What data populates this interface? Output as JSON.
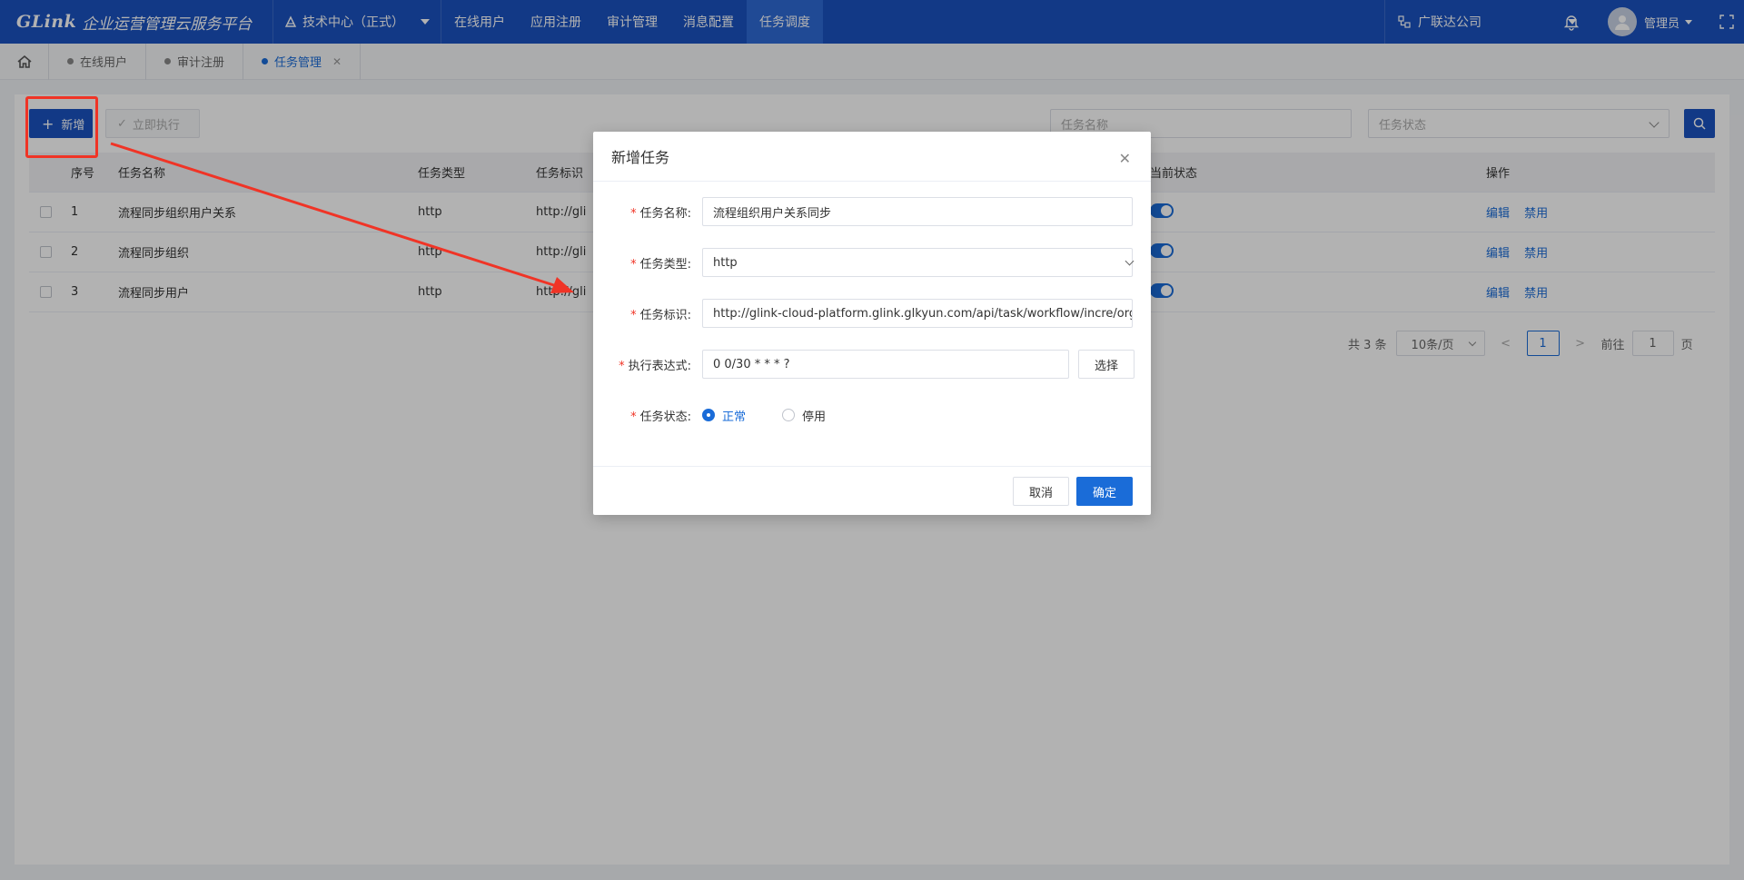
{
  "topbar": {
    "brand": "GLink",
    "title": "企业运营管理云服务平台",
    "org": "技术中心（正式）",
    "nav": [
      "在线用户",
      "应用注册",
      "审计管理",
      "消息配置",
      "任务调度"
    ],
    "company": "广联达公司",
    "user": "管理员"
  },
  "tabs": [
    {
      "label": "在线用户"
    },
    {
      "label": "审计注册"
    },
    {
      "label": "任务管理"
    }
  ],
  "toolbar": {
    "add_label": "新增",
    "run_label": "立即执行",
    "search_placeholder": "任务名称",
    "status_placeholder": "任务状态"
  },
  "table": {
    "headers": [
      "序号",
      "任务名称",
      "任务类型",
      "任务标识",
      "当前状态",
      "操作"
    ],
    "rows": [
      {
        "no": "1",
        "name": "流程同步组织用户关系",
        "type": "http",
        "id": "http://gli"
      },
      {
        "no": "2",
        "name": "流程同步组织",
        "type": "http",
        "id": "http://gli"
      },
      {
        "no": "3",
        "name": "流程同步用户",
        "type": "http",
        "id": "http://gli"
      }
    ],
    "op_edit": "编辑",
    "op_disable": "禁用"
  },
  "pager": {
    "total": "共 3 条",
    "size": "10条/页",
    "current": "1",
    "goto_prefix": "前往",
    "goto_value": "1",
    "goto_suffix": "页"
  },
  "modal": {
    "title": "新增任务",
    "name_label": "任务名称:",
    "name_value": "流程组织用户关系同步",
    "type_label": "任务类型:",
    "type_value": "http",
    "id_label": "任务标识:",
    "id_value": "http://glink-cloud-platform.glink.glkyun.com/api/task/workflow/incre/org/u",
    "cron_label": "执行表达式:",
    "cron_value": "0 0/30 * * * ?",
    "choose_label": "选择",
    "status_label": "任务状态:",
    "status_normal": "正常",
    "status_disabled": "停用",
    "cancel_label": "取消",
    "ok_label": "确定"
  },
  "colors": {
    "topbar": "#1a52c0",
    "primary": "#1a6cd8",
    "annotation": "#f03426"
  }
}
